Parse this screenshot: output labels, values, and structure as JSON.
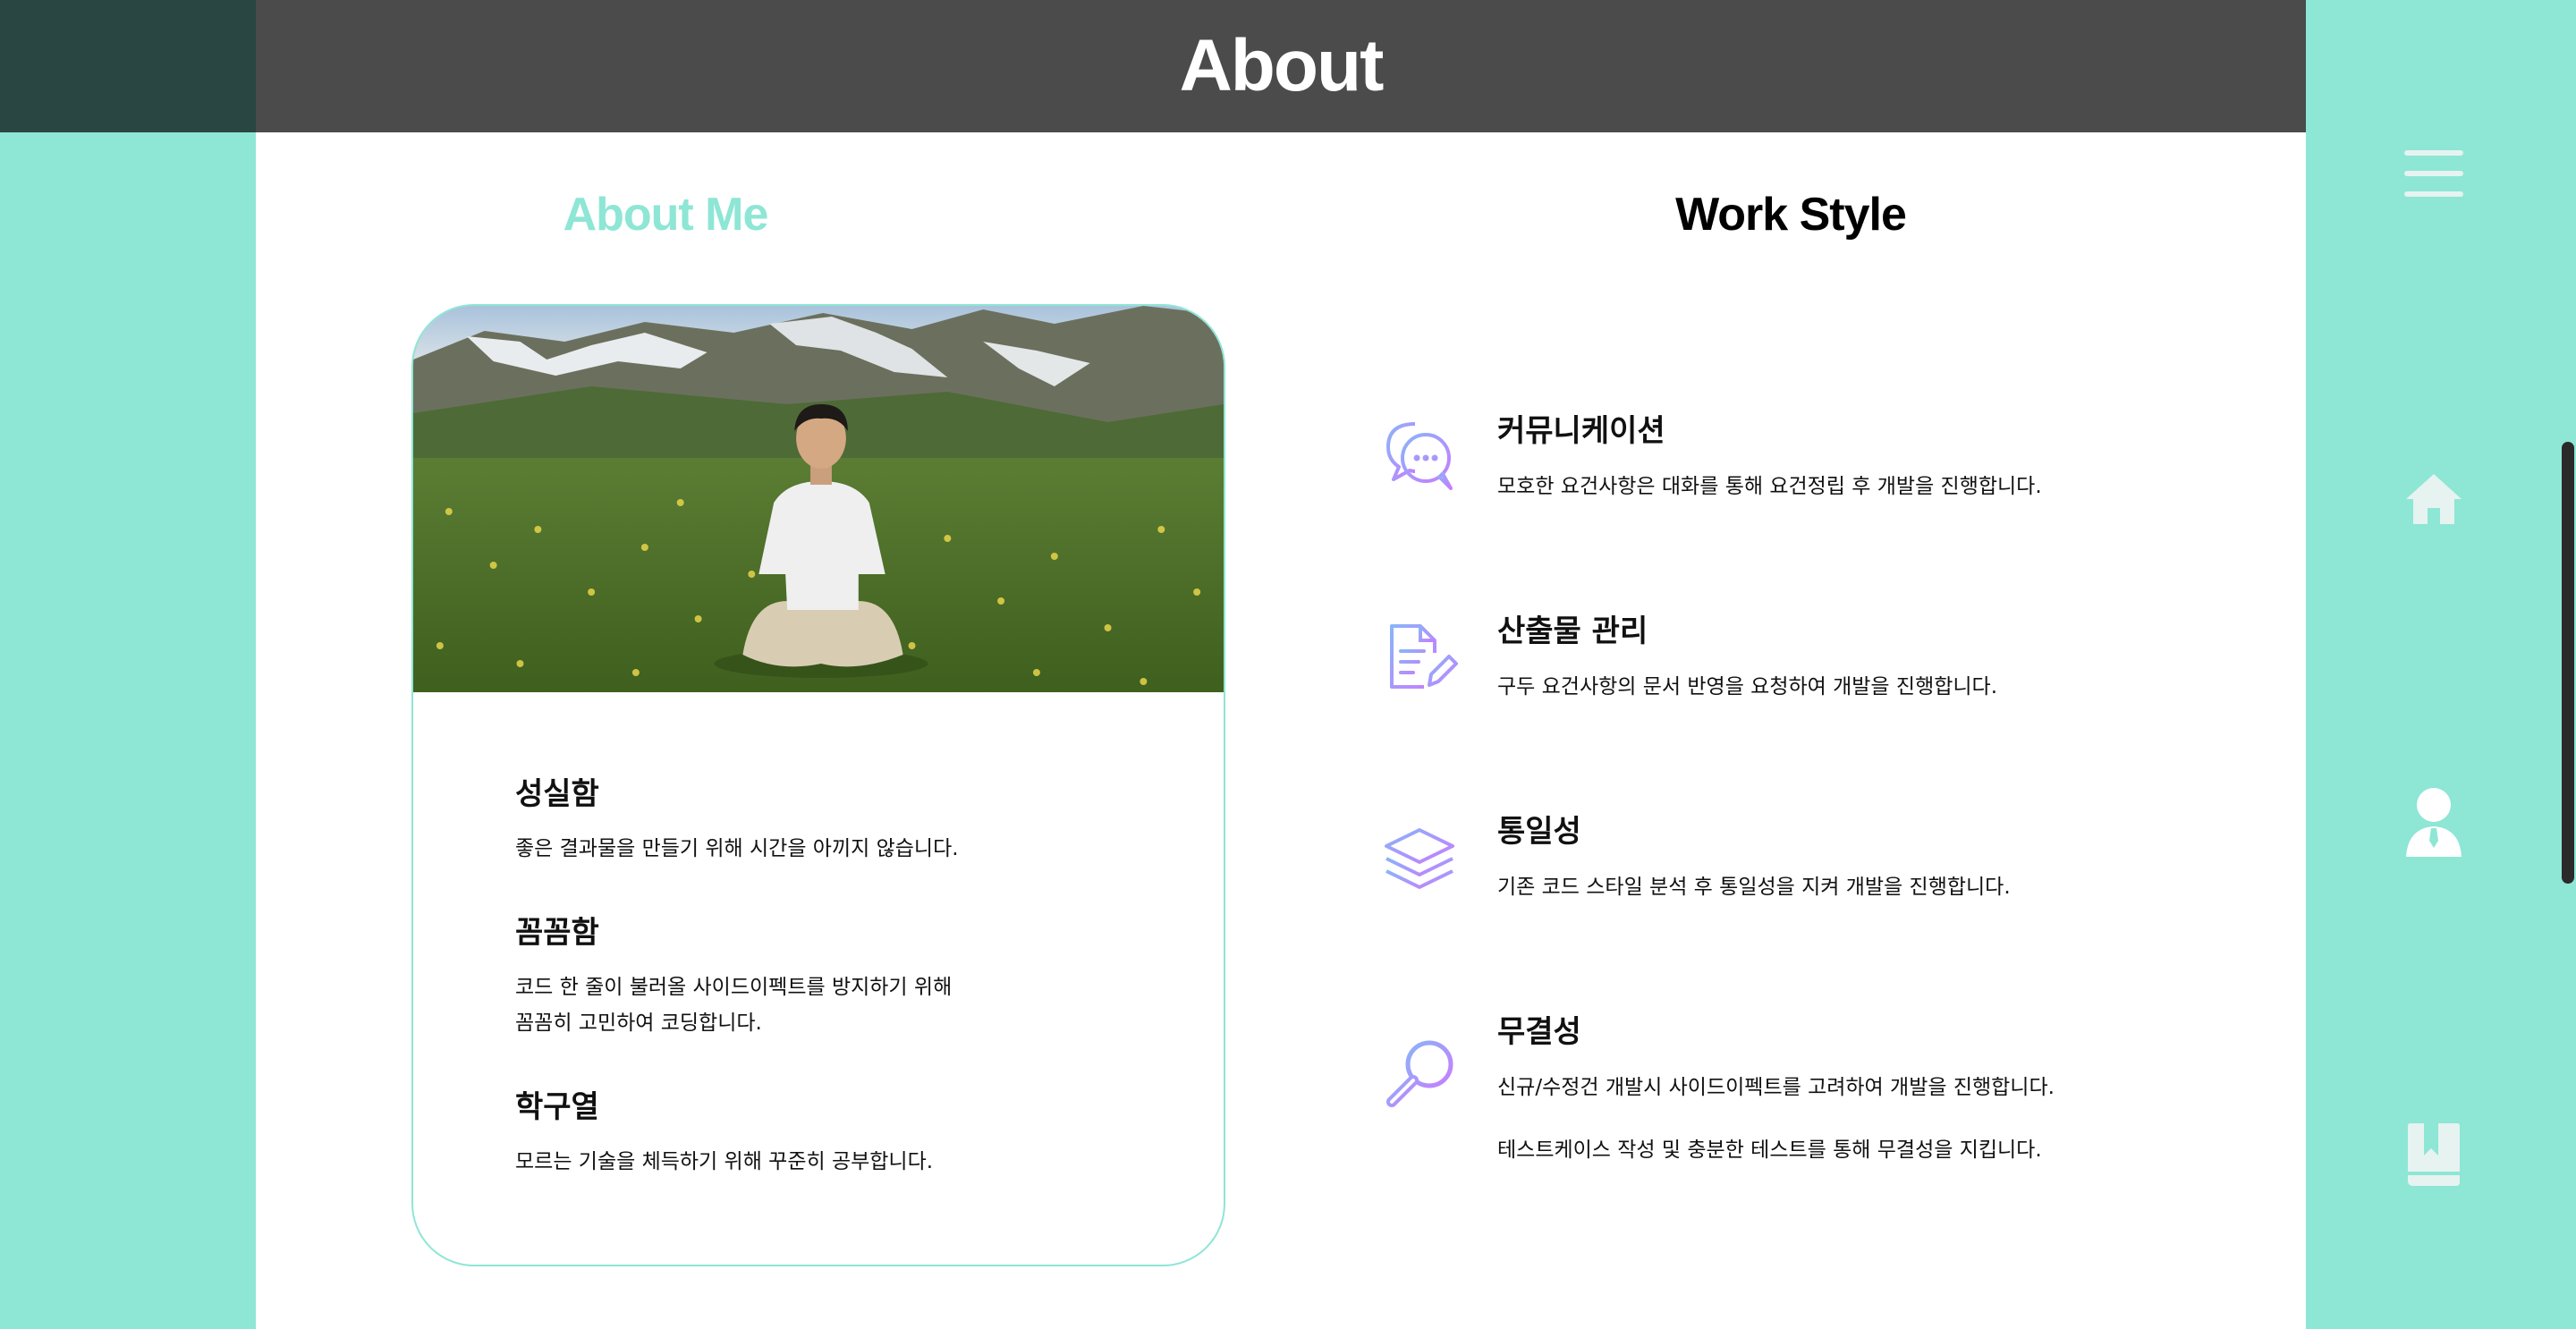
{
  "header": {
    "title": "About"
  },
  "about_me": {
    "title": "About Me",
    "traits": [
      {
        "title": "성실함",
        "desc": "좋은 결과물을 만들기 위해 시간을 아끼지 않습니다."
      },
      {
        "title": "꼼꼼함",
        "desc": "코드 한 줄이 불러올 사이드이펙트를 방지하기 위해\n꼼꼼히 고민하여 코딩합니다."
      },
      {
        "title": "학구열",
        "desc": "모르는 기술을 체득하기 위해 꾸준히 공부합니다."
      }
    ]
  },
  "work_style": {
    "title": "Work Style",
    "items": [
      {
        "icon": "chat-bubbles-icon",
        "title": "커뮤니케이션",
        "lines": [
          "모호한 요건사항은 대화를 통해 요건정립 후 개발을 진행합니다."
        ]
      },
      {
        "icon": "document-edit-icon",
        "title": "산출물 관리",
        "lines": [
          "구두 요건사항의 문서 반영을 요청하여 개발을 진행합니다."
        ]
      },
      {
        "icon": "layers-icon",
        "title": "통일성",
        "lines": [
          "기존 코드 스타일 분석 후 통일성을 지켜 개발을 진행합니다."
        ]
      },
      {
        "icon": "magnifier-icon",
        "title": "무결성",
        "lines": [
          "신규/수정건 개발시 사이드이펙트를 고려하여 개발을 진행합니다.",
          "테스트케이스 작성 및 충분한 테스트를 통해 무결성을 지킵니다."
        ]
      }
    ]
  },
  "nav": [
    "menu-icon",
    "home-icon",
    "profile-icon",
    "bookmark-icon"
  ],
  "colors": {
    "accent": "#8ee6d5",
    "header_bg": "#4b4b4b",
    "icon_gradient_start": "#8ab4f8",
    "icon_gradient_end": "#c77dff"
  }
}
